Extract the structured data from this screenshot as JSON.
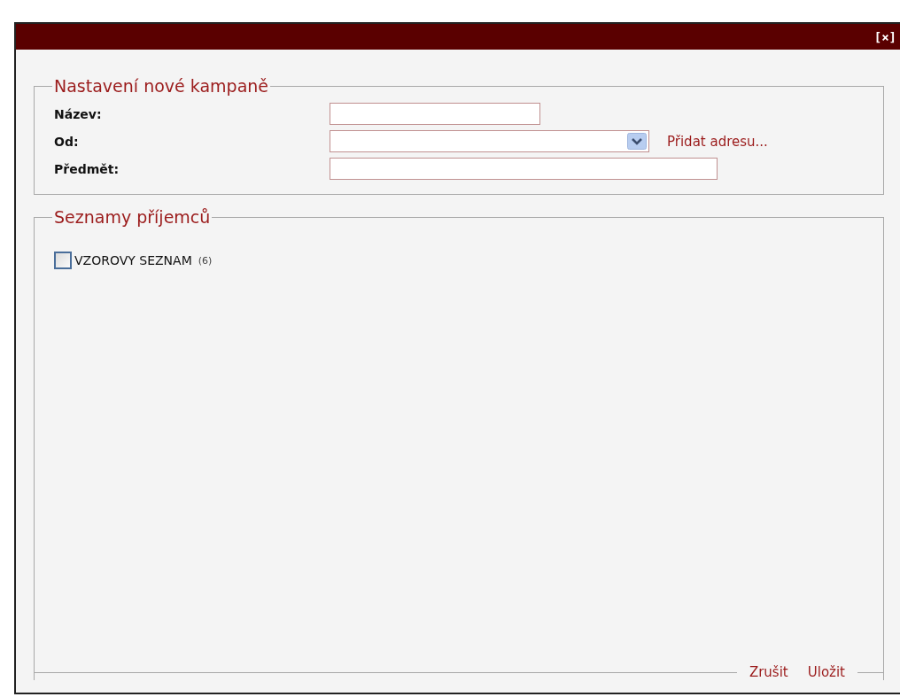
{
  "window": {
    "close": "[×]"
  },
  "campaign": {
    "legend": "Nastavení nové kampaně",
    "fields": [
      {
        "kind": "short",
        "label": "Název:"
      },
      {
        "kind": "select",
        "label": "Od:",
        "link": "Přidat adresu..."
      },
      {
        "kind": "long",
        "label": "Předmět:"
      }
    ]
  },
  "recipients": {
    "legend": "Seznamy příjemců",
    "lists": [
      {
        "name": "VZOROVY SEZNAM",
        "count": "(6)",
        "checked": false
      }
    ]
  },
  "buttons": [
    "Zrušit",
    "Uložit"
  ]
}
